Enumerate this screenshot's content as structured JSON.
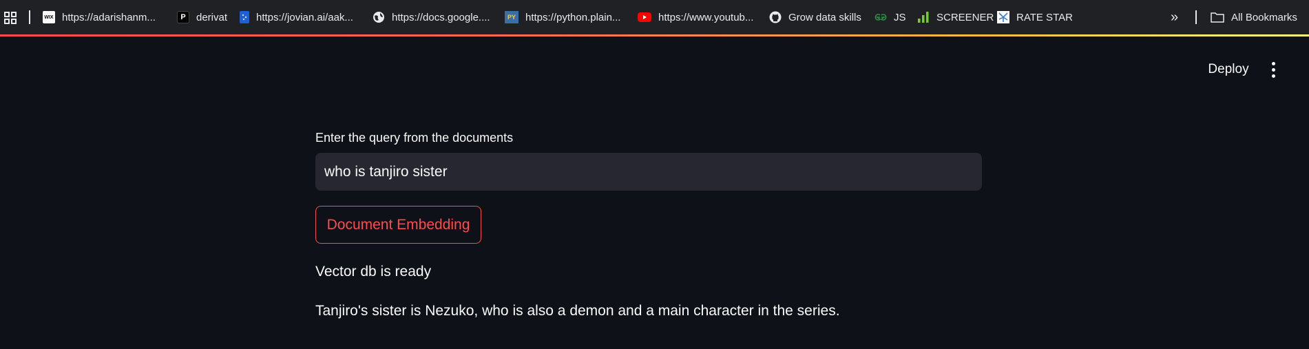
{
  "bookmarks_bar": {
    "items": [
      {
        "label": "https://adarishanm...",
        "icon": "wix-icon"
      },
      {
        "label": "derivat",
        "icon": "p-logo-icon"
      },
      {
        "label": "https://jovian.ai/aak...",
        "icon": "jovian-icon"
      },
      {
        "label": "https://docs.google....",
        "icon": "globe-icon"
      },
      {
        "label": "https://python.plain...",
        "icon": "py-icon"
      },
      {
        "label": "https://www.youtub...",
        "icon": "youtube-icon"
      },
      {
        "label": "Grow data skills",
        "icon": "github-icon"
      },
      {
        "label": "JS",
        "icon": "gfg-icon"
      },
      {
        "label": "SCREENER",
        "icon": "bar-chart-icon"
      },
      {
        "label": "RATE STAR",
        "icon": "ratestar-icon"
      }
    ],
    "overflow": "»",
    "all_bookmarks": "All Bookmarks",
    "icon_text": {
      "wix": "WIX",
      "p": "P",
      "py": "PY"
    }
  },
  "header": {
    "deploy_label": "Deploy"
  },
  "main": {
    "query_label": "Enter the query from the documents",
    "query_value": "who is tanjiro sister",
    "embed_button_label": "Document Embedding",
    "status_text": "Vector db is ready",
    "answer_text": "Tanjiro's sister is Nezuko, who is also a demon and a main character in the series."
  },
  "colors": {
    "background": "#0e1117",
    "bookmarks_bar": "#202124",
    "input_background": "#262730",
    "accent": "#ff4b4b",
    "text": "#fafafa"
  }
}
